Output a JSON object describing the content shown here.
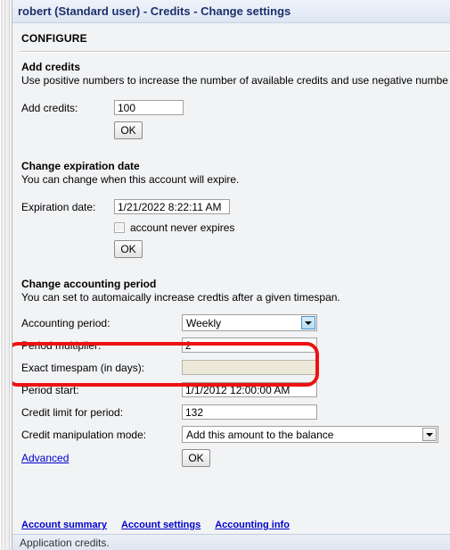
{
  "window": {
    "title": "robert (Standard user) - Credits - Change settings"
  },
  "configure": {
    "heading": "CONFIGURE"
  },
  "sections": {
    "add_credits": {
      "title": "Add credits",
      "description": "Use positive numbers to increase the number of available credits and use negative numbe",
      "field_label": "Add credits:",
      "field_value": "100",
      "ok_label": "OK"
    },
    "expiration": {
      "title": "Change expiration date",
      "description": "You can change when this account will expire.",
      "field_label": "Expiration date:",
      "field_value": "1/21/2022 8:22:11 AM",
      "checkbox_label": "account never expires",
      "checkbox_checked": false,
      "ok_label": "OK"
    },
    "accounting": {
      "title": "Change accounting period",
      "description": "You can set to automaically increase credtis after a given timespan.",
      "rows": [
        {
          "label": "Accounting period:",
          "value": "Weekly",
          "type": "select",
          "focused": true
        },
        {
          "label": "Period multiplier:",
          "value": "2",
          "type": "text"
        },
        {
          "label": "Exact timespam (in days):",
          "value": "",
          "type": "text-disabled"
        },
        {
          "label": "Period start:",
          "value": "1/1/2012 12:00:00 AM",
          "type": "text"
        },
        {
          "label": "Credit limit for period:",
          "value": "132",
          "type": "text"
        },
        {
          "label": "Credit manipulation mode:",
          "value": "Add this amount to the balance",
          "type": "select",
          "focused": false
        }
      ],
      "advanced_link": "Advanced",
      "ok_label": "OK"
    }
  },
  "footer": {
    "links": [
      "Account summary",
      "Account settings",
      "Accounting info"
    ],
    "status": "Application credits."
  },
  "annotation": {
    "color": "#ee1111"
  }
}
